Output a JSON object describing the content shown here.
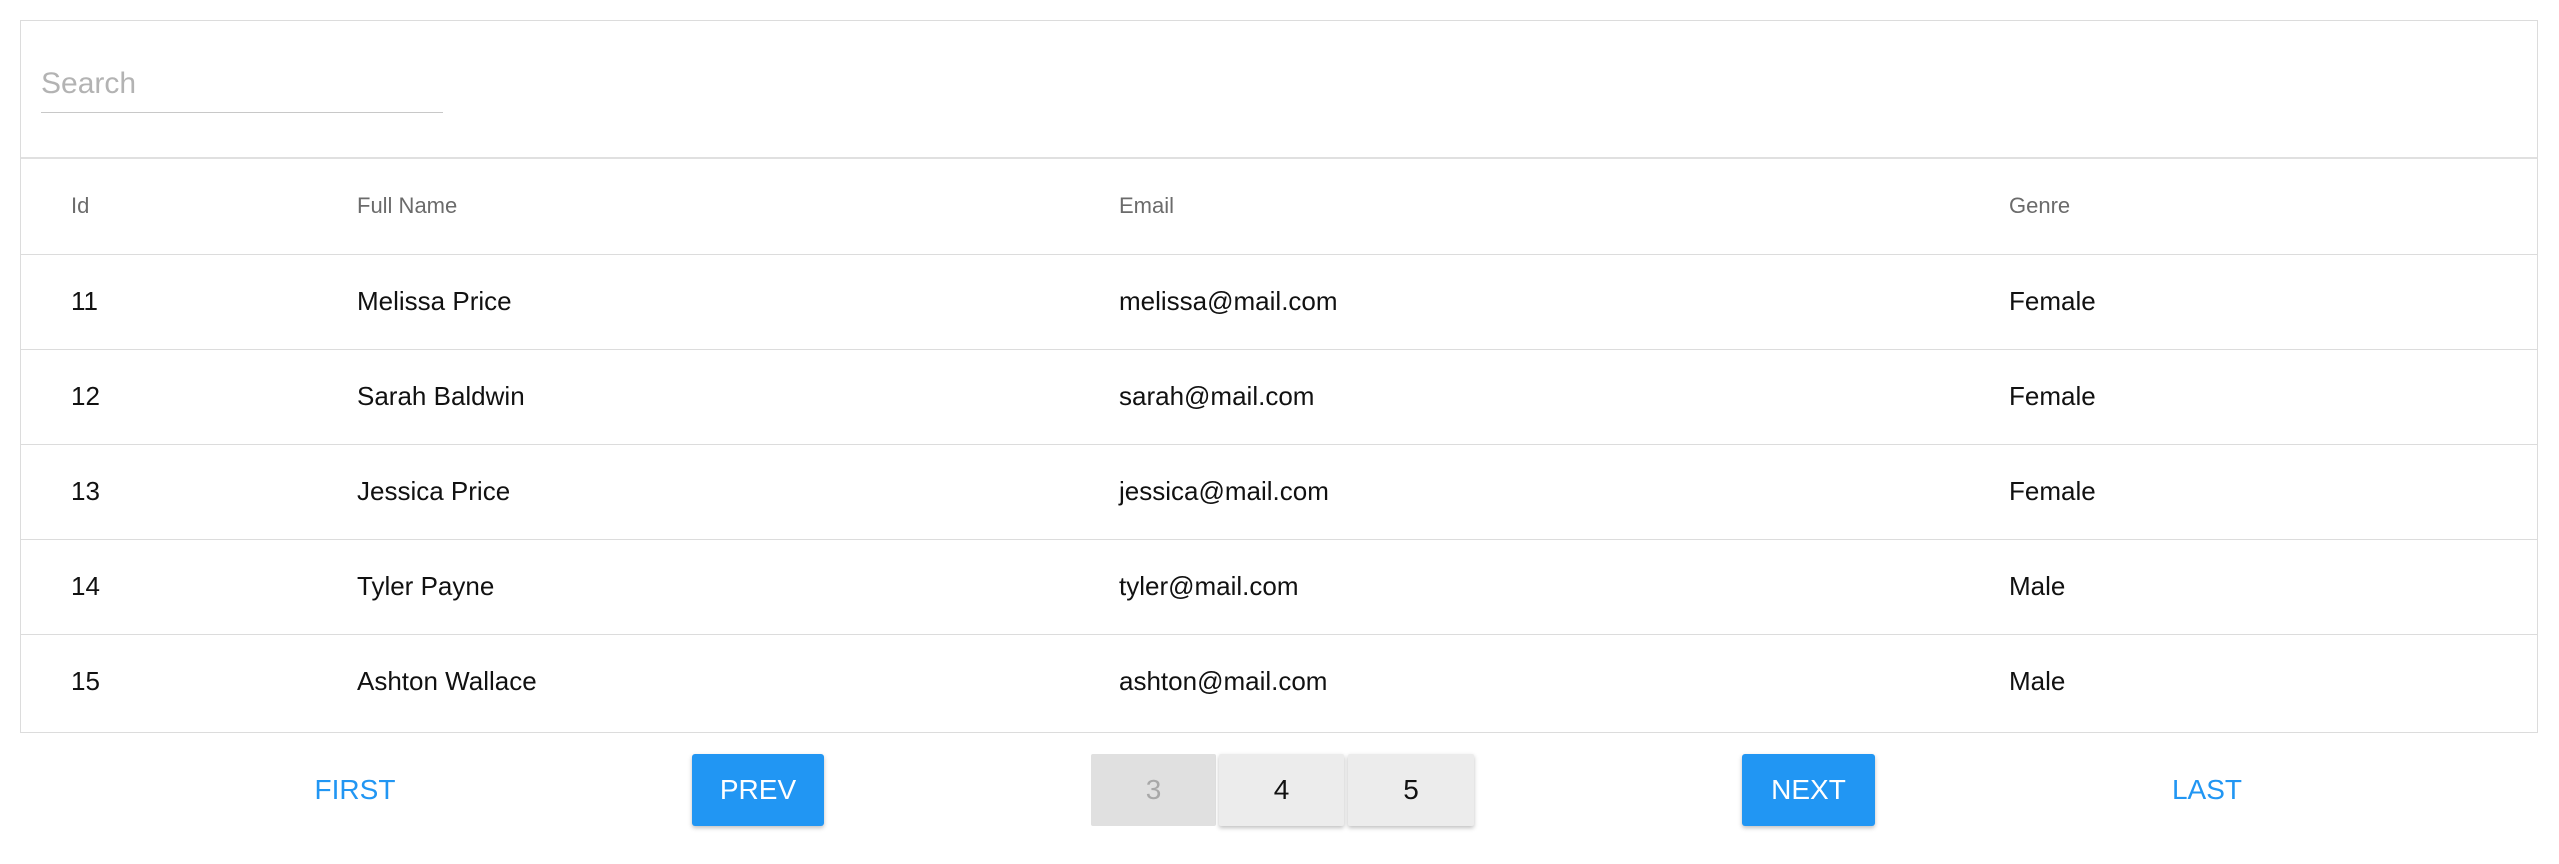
{
  "search": {
    "placeholder": "Search",
    "value": ""
  },
  "table": {
    "headers": [
      "Id",
      "Full Name",
      "Email",
      "Genre"
    ],
    "rows": [
      [
        "11",
        "Melissa Price",
        "melissa@mail.com",
        "Female"
      ],
      [
        "12",
        "Sarah Baldwin",
        "sarah@mail.com",
        "Female"
      ],
      [
        "13",
        "Jessica Price",
        "jessica@mail.com",
        "Female"
      ],
      [
        "14",
        "Tyler Payne",
        "tyler@mail.com",
        "Male"
      ],
      [
        "15",
        "Ashton Wallace",
        "ashton@mail.com",
        "Male"
      ]
    ]
  },
  "pagination": {
    "first_label": "FIRST",
    "prev_label": "PREV",
    "pages": [
      "3",
      "4",
      "5"
    ],
    "current_page": "3",
    "next_label": "NEXT",
    "last_label": "LAST"
  },
  "colors": {
    "accent": "#2196f3",
    "border": "#dcdcdc",
    "header_text": "#6b6b6b"
  }
}
